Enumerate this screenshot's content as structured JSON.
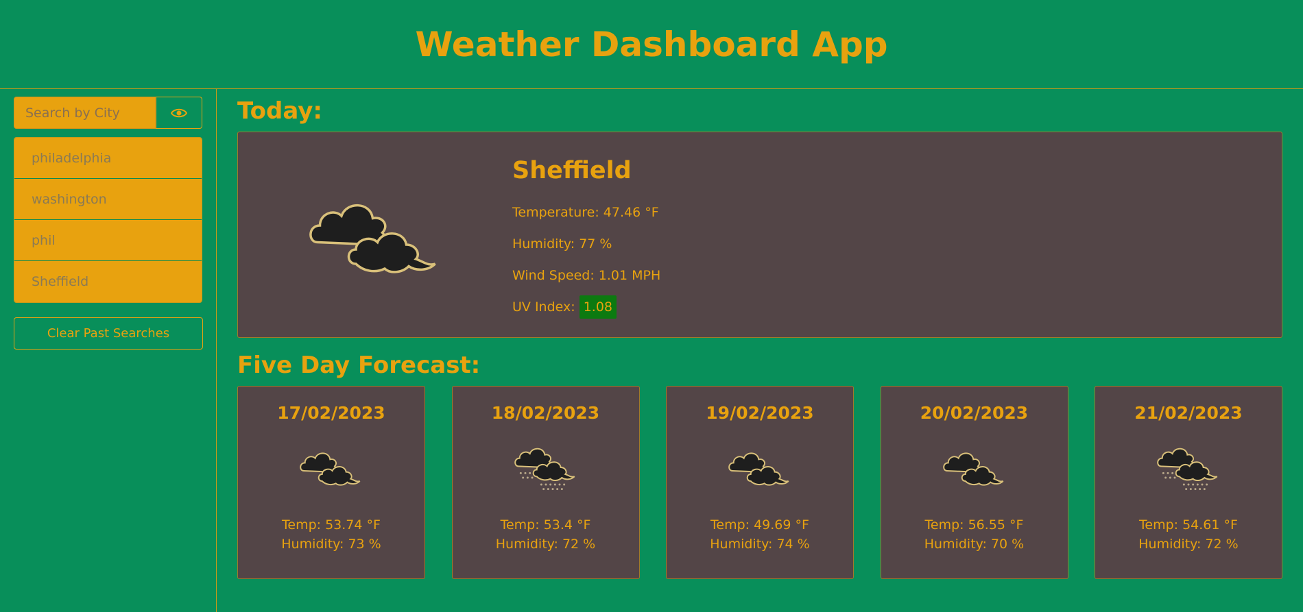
{
  "app": {
    "title": "Weather Dashboard App"
  },
  "search": {
    "placeholder": "Search by City",
    "button_icon": "eye-icon"
  },
  "history": [
    "philadelphia",
    "washington",
    "phil",
    "Sheffield"
  ],
  "clear_label": "Clear Past Searches",
  "today": {
    "heading": "Today:",
    "city": "Sheffield",
    "temperature": "Temperature: 47.46 °F",
    "humidity": "Humidity: 77 %",
    "wind": "Wind Speed: 1.01 MPH",
    "uv_label": "UV Index:",
    "uv_value": "1.08",
    "icon": "cloud-icon"
  },
  "forecast": {
    "heading": "Five Day Forecast:",
    "days": [
      {
        "date": "17/02/2023",
        "icon": "cloud-icon",
        "temp": "Temp: 53.74 °F",
        "humidity": "Humidity: 73 %"
      },
      {
        "date": "18/02/2023",
        "icon": "cloud-rain-icon",
        "temp": "Temp: 53.4 °F",
        "humidity": "Humidity: 72 %"
      },
      {
        "date": "19/02/2023",
        "icon": "cloud-icon",
        "temp": "Temp: 49.69 °F",
        "humidity": "Humidity: 74 %"
      },
      {
        "date": "20/02/2023",
        "icon": "cloud-icon",
        "temp": "Temp: 56.55 °F",
        "humidity": "Humidity: 70 %"
      },
      {
        "date": "21/02/2023",
        "icon": "cloud-rain-icon",
        "temp": "Temp: 54.61 °F",
        "humidity": "Humidity: 72 %"
      }
    ]
  },
  "colors": {
    "background": "#088f5a",
    "accent": "#e8a20f",
    "card": "#534547",
    "uv_badge": "#0c7a10"
  }
}
